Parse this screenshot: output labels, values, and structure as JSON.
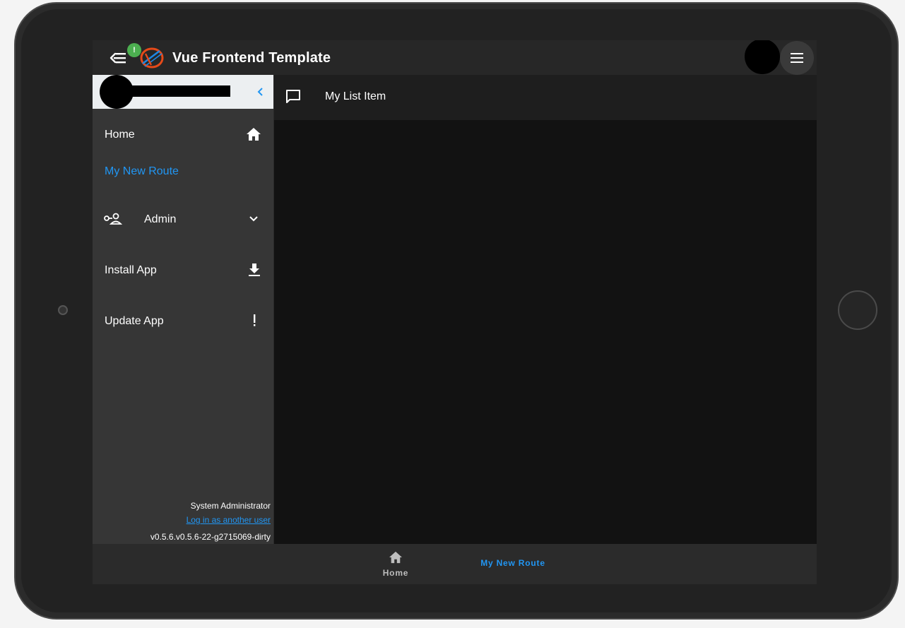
{
  "appbar": {
    "title": "Vue Frontend Template",
    "badge": "!",
    "icons": {
      "menu_toggle": "menu-open-icon",
      "logo": "app-logo",
      "right_menu": "hamburger-icon"
    }
  },
  "sidebar": {
    "collapse_icon": "chevron-left-icon",
    "items": [
      {
        "label": "Home",
        "icon": "home-icon"
      },
      {
        "label": "My New Route",
        "active": true
      },
      {
        "label": "Admin",
        "icon": "account-key-icon",
        "expand_icon": "chevron-down-icon"
      },
      {
        "label": "Install App",
        "icon": "download-icon"
      },
      {
        "label": "Update App",
        "icon": "exclamation-icon"
      }
    ],
    "footer": {
      "user_role": "System Administrator",
      "login_link": "Log in as another user",
      "version": "v0.5.6.v0.5.6-22-g2715069-dirty"
    }
  },
  "content": {
    "title": "My List Item",
    "icon": "message-icon"
  },
  "bottom_nav": {
    "items": [
      {
        "label": "Home",
        "icon": "home-icon"
      },
      {
        "label": "My New Route",
        "active": true
      }
    ]
  },
  "colors": {
    "accent": "#2196f3",
    "badge": "#4caf50",
    "appbar_bg": "#272727",
    "sidebar_bg": "#363636",
    "content_bg": "#121212"
  }
}
